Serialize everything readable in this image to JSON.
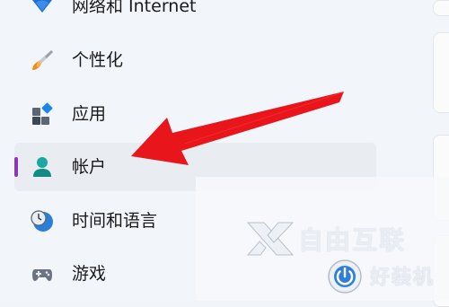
{
  "nav": {
    "items": [
      {
        "label": "网络和 Internet",
        "icon": "wifi-icon"
      },
      {
        "label": "个性化",
        "icon": "paintbrush-icon"
      },
      {
        "label": "应用",
        "icon": "apps-icon"
      },
      {
        "label": "帐户",
        "icon": "account-icon",
        "selected": true
      },
      {
        "label": "时间和语言",
        "icon": "clock-globe-icon"
      },
      {
        "label": "游戏",
        "icon": "gamepad-icon"
      }
    ]
  },
  "accent_color": "#8a38b3",
  "annotation": {
    "arrow_color": "#e8161b",
    "points_to": "帐户"
  },
  "watermarks": {
    "primary": "自由互联",
    "secondary": "好装机"
  }
}
